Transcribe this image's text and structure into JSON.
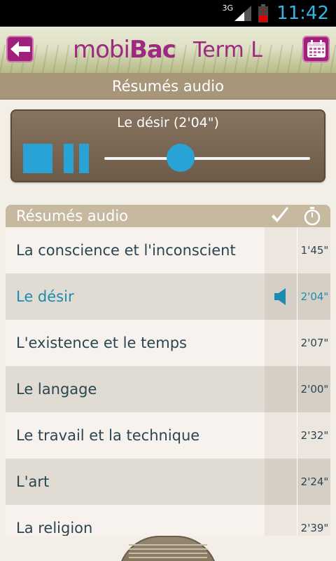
{
  "status_bar": {
    "network": "3G",
    "time": "11:42"
  },
  "header": {
    "logo_part1": "mobi",
    "logo_part2": "Bac",
    "subtitle": "Term L",
    "back_icon": "back-arrow-icon",
    "calendar_icon": "calendar-icon"
  },
  "section_title": "Résumés audio",
  "player": {
    "title": "Le désir  (2'04\")",
    "progress": 0.37
  },
  "list": {
    "header": "Résumés audio",
    "items": [
      {
        "label": "La conscience et l'inconscient",
        "duration": "1'45\"",
        "playing": false
      },
      {
        "label": "Le désir",
        "duration": "2'04\"",
        "playing": true
      },
      {
        "label": "L'existence et le temps",
        "duration": "2'07\"",
        "playing": false
      },
      {
        "label": "Le langage",
        "duration": "2'00\"",
        "playing": false
      },
      {
        "label": "Le travail et la technique",
        "duration": "2'32\"",
        "playing": false
      },
      {
        "label": "L'art",
        "duration": "2'24\"",
        "playing": false
      },
      {
        "label": "La religion",
        "duration": "2'39\"",
        "playing": false
      }
    ]
  },
  "colors": {
    "accent": "#29a3d6",
    "brand": "#9b2a80"
  }
}
